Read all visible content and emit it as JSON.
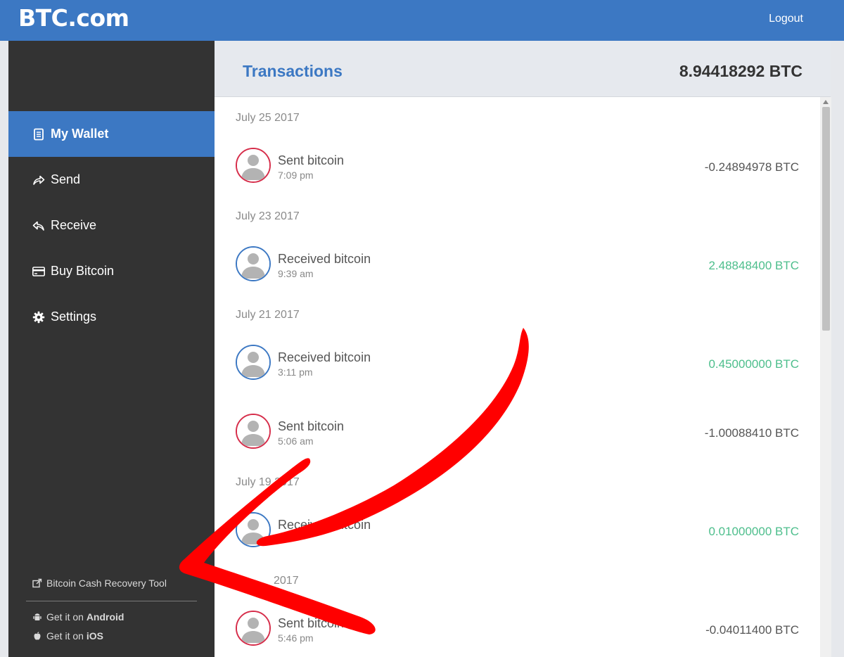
{
  "header": {
    "logo": "BTC.com",
    "logout_label": "Logout"
  },
  "sidebar": {
    "items": [
      {
        "label": "My Wallet",
        "icon": "wallet-icon",
        "active": true
      },
      {
        "label": "Send",
        "icon": "send-icon",
        "active": false
      },
      {
        "label": "Receive",
        "icon": "receive-icon",
        "active": false
      },
      {
        "label": "Buy Bitcoin",
        "icon": "credit-card-icon",
        "active": false
      },
      {
        "label": "Settings",
        "icon": "gear-icon",
        "active": false
      }
    ],
    "recovery_tool_label": "Bitcoin Cash Recovery Tool",
    "android_prefix": "Get it on ",
    "android_label": "Android",
    "ios_prefix": "Get it on ",
    "ios_label": "iOS"
  },
  "main": {
    "title": "Transactions",
    "balance": "8.94418292 BTC",
    "dates": [
      "July 25 2017",
      "July 23 2017",
      "July 21 2017",
      "July 19 2017",
      "2017"
    ],
    "transactions": [
      {
        "label": "Sent bitcoin",
        "time": "7:09 pm",
        "amount": "-0.24894978 BTC",
        "direction": "sent"
      },
      {
        "label": "Received bitcoin",
        "time": "9:39 am",
        "amount": "2.48848400 BTC",
        "direction": "received"
      },
      {
        "label": "Received bitcoin",
        "time": "3:11 pm",
        "amount": "0.45000000 BTC",
        "direction": "received"
      },
      {
        "label": "Sent bitcoin",
        "time": "5:06 am",
        "amount": "-1.00088410 BTC",
        "direction": "sent"
      },
      {
        "label": "Received bitcoin",
        "time": "",
        "amount": "0.01000000 BTC",
        "direction": "received"
      },
      {
        "label": "Sent bitcoin",
        "time": "5:46 pm",
        "amount": "-0.04011400 BTC",
        "direction": "sent"
      }
    ]
  },
  "colors": {
    "brand_blue": "#3c78c3",
    "sidebar_bg": "#333333",
    "positive_amount": "#4dbe8c",
    "sent_avatar_border": "#d62d4a",
    "annotation_arrow": "#ff0000"
  }
}
